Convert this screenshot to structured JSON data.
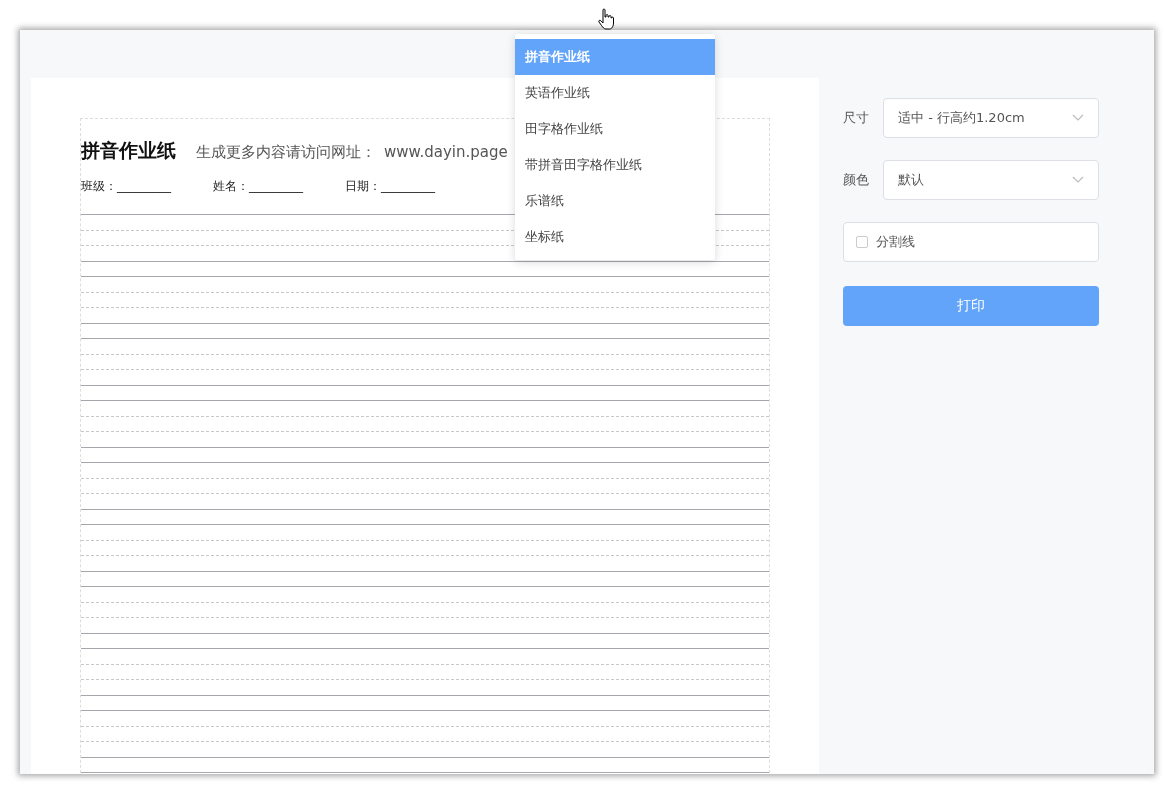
{
  "paper": {
    "title": "拼音作业纸",
    "notice": "生成更多内容请访问网址：",
    "url": "www.dayin.page",
    "fields": [
      "班级：_________",
      "姓名：_________",
      "日期：_________"
    ]
  },
  "settings": {
    "size": {
      "label": "尺寸",
      "value": "适中 - 行高约1.20cm"
    },
    "color": {
      "label": "颜色",
      "value": "默认"
    },
    "divider": {
      "label": "分割线",
      "checked": false
    },
    "print_button": "打印"
  },
  "dropdown": {
    "items": [
      {
        "label": "拼音作业纸",
        "selected": true
      },
      {
        "label": "英语作业纸",
        "selected": false
      },
      {
        "label": "田字格作业纸",
        "selected": false
      },
      {
        "label": "带拼音田字格作业纸",
        "selected": false
      },
      {
        "label": "乐谱纸",
        "selected": false
      },
      {
        "label": "坐标纸",
        "selected": false
      }
    ]
  }
}
